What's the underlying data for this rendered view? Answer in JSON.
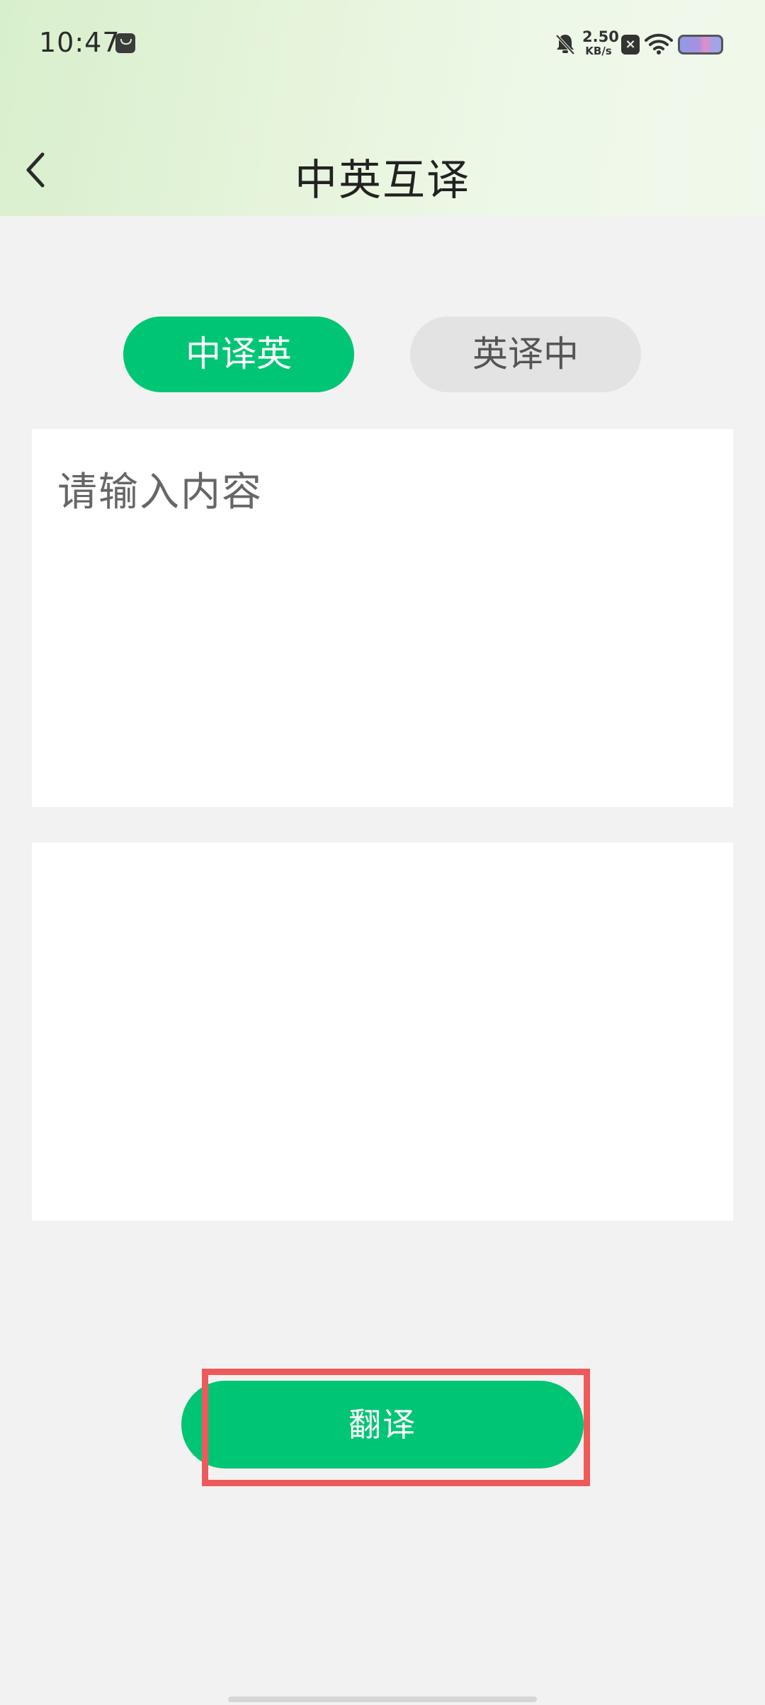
{
  "status_bar": {
    "time": "10:47",
    "net_speed_value": "2.50",
    "net_speed_unit": "KB/s",
    "icons": [
      "bag-icon",
      "bell-off-icon",
      "close-box-icon",
      "wifi-icon",
      "battery-icon"
    ]
  },
  "header": {
    "title": "中英互译",
    "back_icon": "chevron-left-icon"
  },
  "tabs": [
    {
      "label": "中译英",
      "active": true
    },
    {
      "label": "英译中",
      "active": false
    }
  ],
  "input": {
    "placeholder": "请输入内容",
    "value": ""
  },
  "output": {
    "value": ""
  },
  "translate_button": {
    "label": "翻译"
  },
  "colors": {
    "accent": "#00c574",
    "highlight": "#ee5a5a",
    "background": "#f2f2f2"
  }
}
